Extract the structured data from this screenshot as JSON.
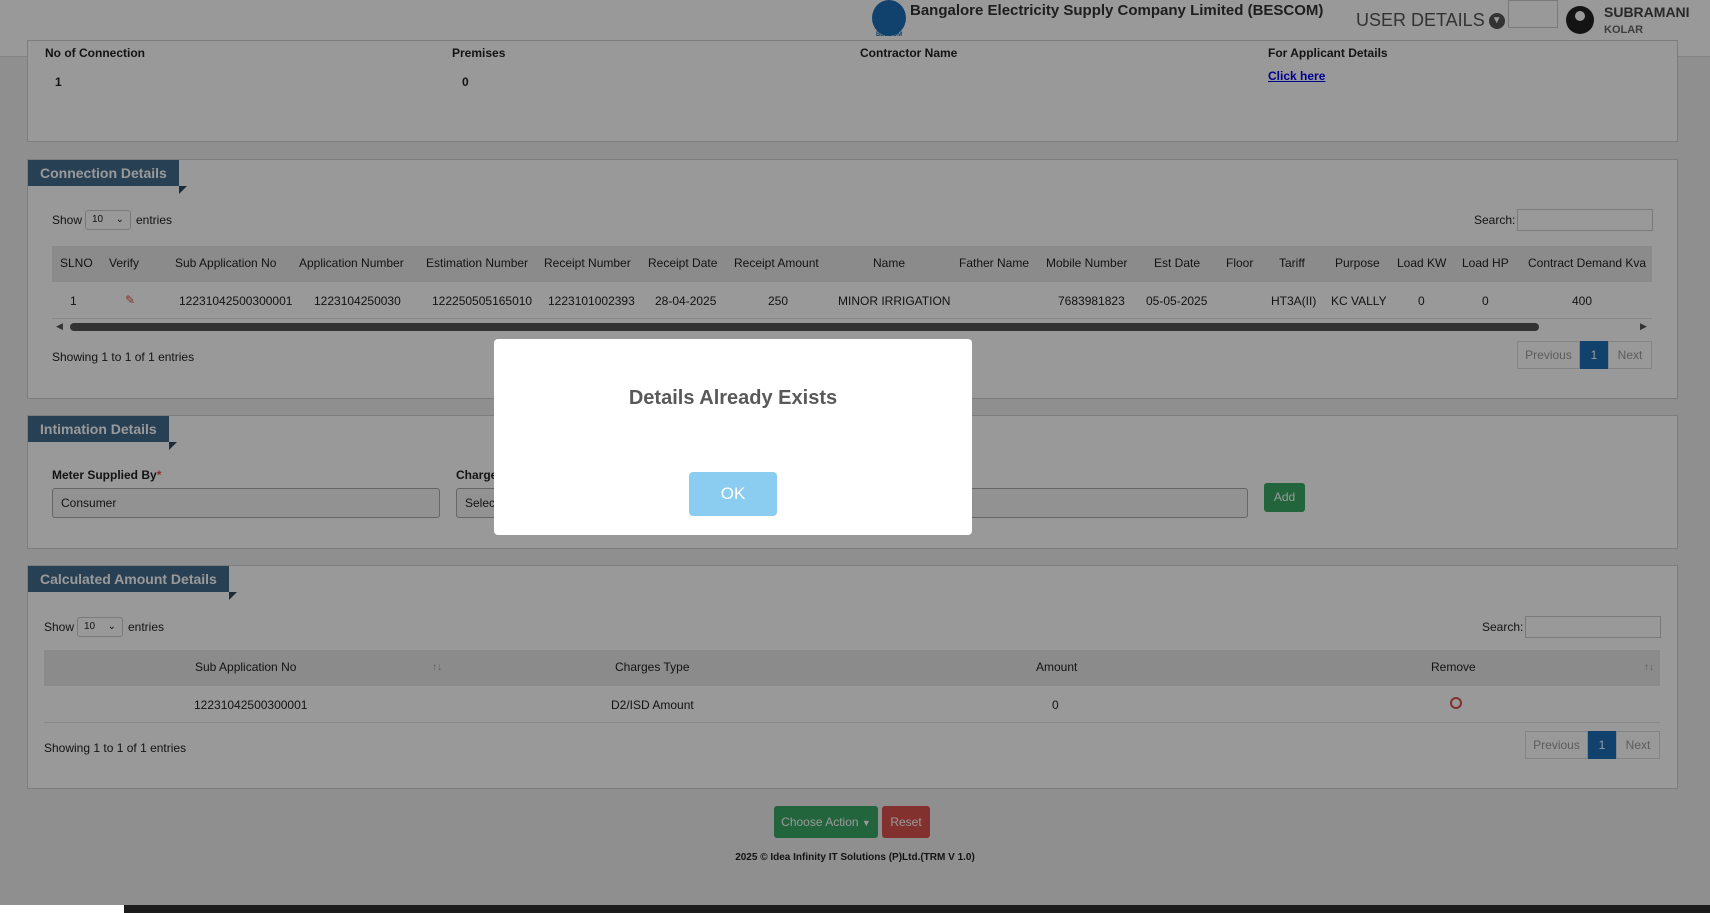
{
  "header": {
    "company": "Bangalore Electricity Supply Company Limited (BESCOM)",
    "logo_text": "BESCOM",
    "user_details": "USER DETAILS",
    "user_name": "SUBRAMANI",
    "user_location": "KOLAR"
  },
  "top_panel": {
    "col1_label": "No of Connection",
    "col1_value": "1",
    "col2_label": "Premises",
    "col2_value": "0",
    "col3_label": "Contractor Name",
    "col4_label": "For Applicant Details",
    "col4_link": "Click here"
  },
  "connection_details": {
    "title": "Connection Details",
    "show": "Show",
    "entries_value": "10",
    "entries": "entries",
    "search_label": "Search:",
    "columns": [
      "SLNO",
      "Verify",
      "Sub Application No",
      "Application Number",
      "Estimation Number",
      "Receipt Number",
      "Receipt Date",
      "Receipt Amount",
      "Name",
      "Father Name",
      "Mobile Number",
      "Est Date",
      "Floor",
      "Tariff",
      "Purpose",
      "Load KW",
      "Load HP",
      "Contract Demand Kva"
    ],
    "row": {
      "slno": "1",
      "sub_app": "12231042500300001",
      "app_no": "1223104250030",
      "est_no": "122250505165010",
      "receipt_no": "1223101002393",
      "receipt_date": "28-04-2025",
      "receipt_amount": "250",
      "name": "MINOR IRRIGATION",
      "mobile": "7683981823",
      "est_date": "05-05-2025",
      "tariff": "HT3A(II)",
      "purpose": "KC VALLY",
      "load_kw": "0",
      "load_hp": "0",
      "contract_demand": "400"
    },
    "showing": "Showing 1 to 1 of 1 entries",
    "prev": "Previous",
    "page": "1",
    "next": "Next"
  },
  "intimation": {
    "title": "Intimation Details",
    "meter_label": "Meter Supplied By",
    "required": "*",
    "meter_value": "Consumer",
    "charges_label": "Charge",
    "charges_value": "Select",
    "add": "Add"
  },
  "calculated": {
    "title": "Calculated Amount Details",
    "show": "Show",
    "entries_value": "10",
    "entries": "entries",
    "search_label": "Search:",
    "columns": [
      "Sub Application No",
      "Charges Type",
      "Amount",
      "Remove"
    ],
    "row": {
      "sub_app": "12231042500300001",
      "charges_type": "D2/ISD Amount",
      "amount": "0"
    },
    "showing": "Showing 1 to 1 of 1 entries",
    "prev": "Previous",
    "page": "1",
    "next": "Next"
  },
  "actions": {
    "choose": "Choose Action",
    "reset": "Reset"
  },
  "footer": "2025 © Idea Infinity IT Solutions (P)Ltd.(TRM V 1.0)",
  "modal": {
    "title": "Details Already Exists",
    "ok": "OK"
  },
  "colors": {
    "panel_title": "#436c8c",
    "green": "#3aa865",
    "red": "#d9534f",
    "blue": "#1d6fb8",
    "ok": "#8bcdf0"
  }
}
